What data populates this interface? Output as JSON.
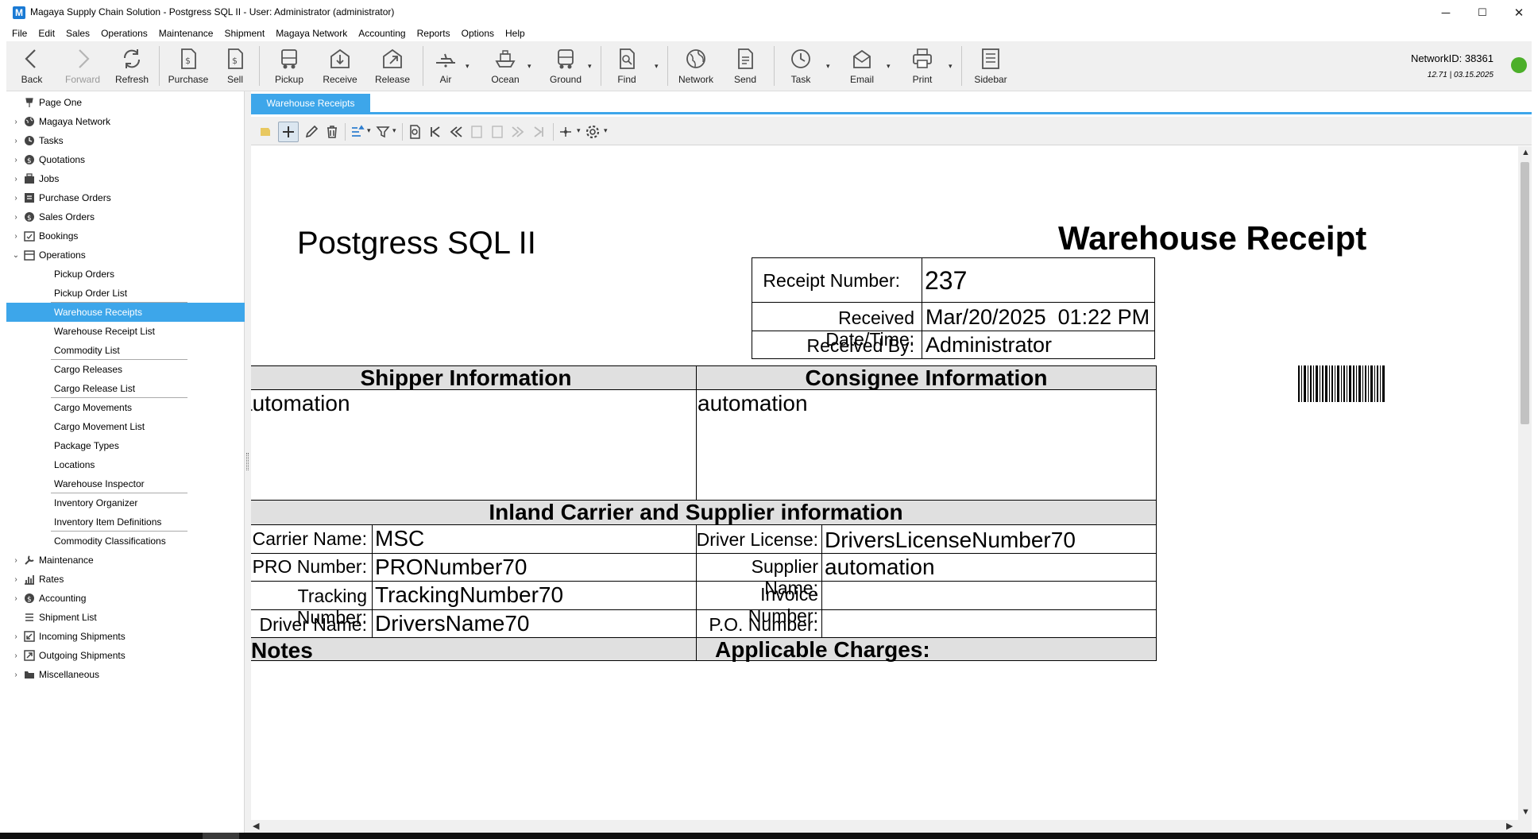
{
  "window": {
    "title": "Magaya Supply Chain Solution - Postgress SQL II - User: Administrator (administrator)",
    "app_icon_letter": "M",
    "minimize_glyph": "─",
    "maximize_glyph": "☐",
    "close_glyph": "✕"
  },
  "menu": [
    "File",
    "Edit",
    "Sales",
    "Operations",
    "Maintenance",
    "Shipment",
    "Magaya Network",
    "Accounting",
    "Reports",
    "Options",
    "Help"
  ],
  "toolbar": {
    "back": "Back",
    "forward": "Forward",
    "refresh": "Refresh",
    "purchase": "Purchase",
    "sell": "Sell",
    "pickup": "Pickup",
    "receive": "Receive",
    "release": "Release",
    "air": "Air",
    "ocean": "Ocean",
    "ground": "Ground",
    "find": "Find",
    "network": "Network",
    "send": "Send",
    "task": "Task",
    "email": "Email",
    "print": "Print",
    "sidebar": "Sidebar",
    "dropdown_glyph": "▾"
  },
  "status": {
    "network_id": "NetworkID: 38361",
    "version": "12.71 | 03.15.2025",
    "connection_color": "#4caf2a"
  },
  "tree": {
    "items": [
      {
        "label": "Page One",
        "expander": ""
      },
      {
        "label": "Magaya Network",
        "expander": "›"
      },
      {
        "label": "Tasks",
        "expander": "›"
      },
      {
        "label": "Quotations",
        "expander": "›"
      },
      {
        "label": "Jobs",
        "expander": "›"
      },
      {
        "label": "Purchase Orders",
        "expander": "›"
      },
      {
        "label": "Sales Orders",
        "expander": "›"
      },
      {
        "label": "Bookings",
        "expander": "›"
      },
      {
        "label": "Operations",
        "expander": "⌄"
      }
    ],
    "operations_children": [
      "Pickup Orders",
      "Pickup Order List",
      "Warehouse Receipts",
      "Warehouse Receipt List",
      "Commodity List",
      "Cargo Releases",
      "Cargo Release List",
      "Cargo Movements",
      "Cargo Movement List",
      "Package Types",
      "Locations",
      "Warehouse Inspector",
      "Inventory Organizer",
      "Inventory Item Definitions",
      "Commodity Classifications"
    ],
    "items_after": [
      {
        "label": "Maintenance",
        "expander": "›"
      },
      {
        "label": "Rates",
        "expander": "›"
      },
      {
        "label": "Accounting",
        "expander": "›"
      },
      {
        "label": "Shipment List",
        "expander": ""
      },
      {
        "label": "Incoming Shipments",
        "expander": "›"
      },
      {
        "label": "Outgoing Shipments",
        "expander": "›"
      },
      {
        "label": "Miscellaneous",
        "expander": "›"
      }
    ],
    "selected_color": "#3da6ea"
  },
  "tab": {
    "active": "Warehouse Receipts"
  },
  "report": {
    "company": "Postgress SQL II",
    "title": "Warehouse Receipt",
    "receipt_number_label": "Receipt Number:",
    "receipt_number": "237",
    "received_date_label": "Received Date/Time:",
    "received_date": "Mar/20/2025  01:22 PM",
    "received_by_label": "Received By:",
    "received_by": "Administrator",
    "shipper_header": "Shipper Information",
    "shipper": "automation",
    "consignee_header": "Consignee Information",
    "consignee": "automation",
    "carrier_header": "Inland Carrier and Supplier information",
    "carrier_name_label": "Carrier Name:",
    "carrier_name": "MSC",
    "pro_number_label": "PRO Number:",
    "pro_number": "PRONumber70",
    "tracking_number_label": "Tracking Number:",
    "tracking_number": "TrackingNumber70",
    "driver_name_label": "Driver Name:",
    "driver_name": "DriversName70",
    "driver_license_label": "Driver License:",
    "driver_license": "DriversLicenseNumber70",
    "supplier_name_label": "Supplier Name:",
    "supplier_name": "automation",
    "invoice_number_label": "Invoice Number:",
    "invoice_number": "",
    "po_number_label": "P.O. Number:",
    "po_number": "",
    "notes_header": "Notes",
    "charges_header": "Applicable Charges:"
  }
}
